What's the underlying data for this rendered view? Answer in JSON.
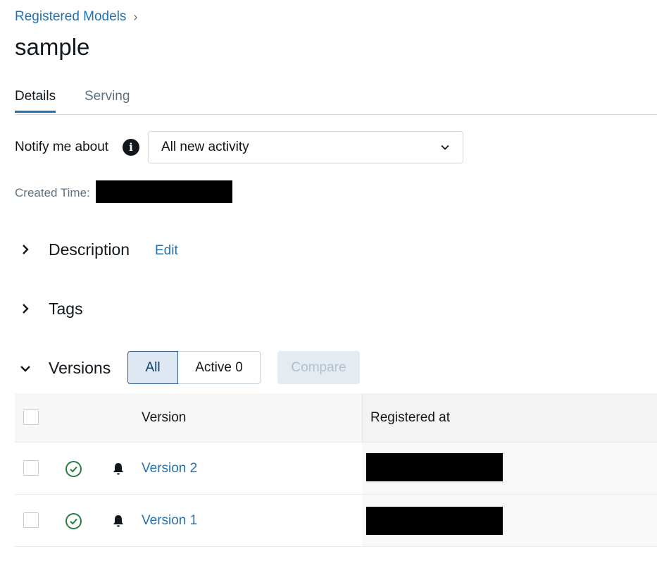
{
  "breadcrumb": {
    "parent": "Registered Models",
    "separator": "›"
  },
  "page": {
    "title": "sample"
  },
  "tabs": [
    {
      "label": "Details"
    },
    {
      "label": "Serving"
    }
  ],
  "notify": {
    "label": "Notify me about",
    "info_icon": "info-icon",
    "selected": "All new activity",
    "chevron": "chevron-down-icon"
  },
  "created": {
    "label": "Created Time:"
  },
  "sections": {
    "description": {
      "title": "Description",
      "edit": "Edit"
    },
    "tags": {
      "title": "Tags"
    },
    "versions": {
      "title": "Versions"
    }
  },
  "filters": {
    "all": "All",
    "active": "Active 0"
  },
  "compare_label": "Compare",
  "table": {
    "headers": {
      "version": "Version",
      "registered_at": "Registered at"
    },
    "rows": [
      {
        "version": "Version 2",
        "status_icon": "check-circle-icon",
        "notify_icon": "bell-icon"
      },
      {
        "version": "Version 1",
        "status_icon": "check-circle-icon",
        "notify_icon": "bell-icon"
      }
    ]
  },
  "colors": {
    "link": "#2272b4",
    "success": "#277c43",
    "segment_selected_bg": "#dde8f3"
  }
}
